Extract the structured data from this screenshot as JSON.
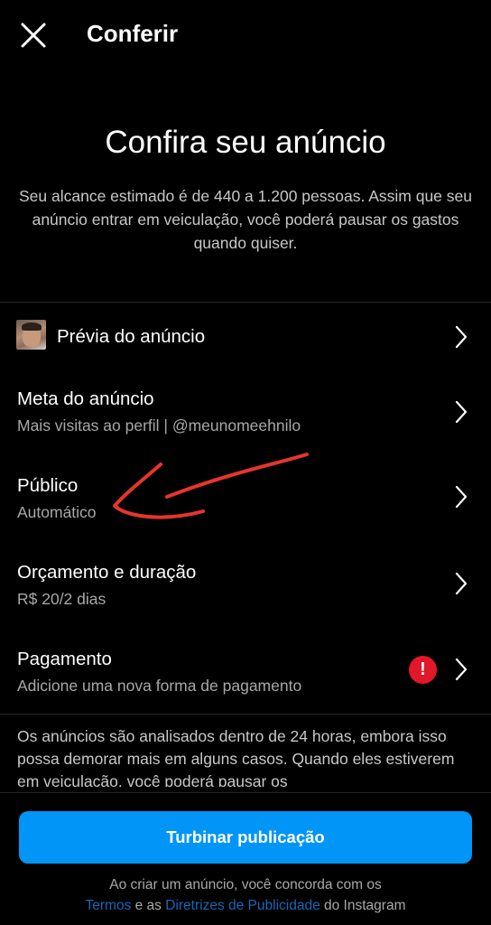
{
  "header": {
    "title": "Conferir",
    "close_icon": "close-icon"
  },
  "intro": {
    "title": "Confira seu anúncio",
    "description": "Seu alcance estimado é de 440 a 1.200 pessoas. Assim que seu anúncio entrar em veiculação, você poderá pausar os gastos quando quiser."
  },
  "rows": [
    {
      "title": "Prévia do anúncio",
      "subtitle": ""
    },
    {
      "title": "Meta do anúncio",
      "subtitle": "Mais visitas ao perfil | @meunomeehnilo"
    },
    {
      "title": "Público",
      "subtitle": "Automático"
    },
    {
      "title": "Orçamento e duração",
      "subtitle": "R$ 20/2 dias"
    },
    {
      "title": "Pagamento",
      "subtitle": "Adicione uma nova forma de pagamento",
      "alert": "!"
    }
  ],
  "notice": "Os anúncios são analisados dentro de 24 horas, embora isso possa demorar mais em alguns casos. Quando eles estiverem em veiculação, você poderá pausar os",
  "cta": {
    "label": "Turbinar publicação"
  },
  "terms": {
    "line1": "Ao criar um anúncio, você concorda com os",
    "link_terms": "Termos",
    "middle": " e as ",
    "link_guidelines": "Diretrizes de Publicidade",
    "suffix": " do Instagram"
  },
  "colors": {
    "background": "#000000",
    "primary_button": "#0095f6",
    "link": "#1a67b8",
    "alert": "#e0182a",
    "annotation": "#e8342c"
  },
  "icons": [
    "close-icon",
    "chevron-right-icon",
    "alert-icon",
    "avatar"
  ]
}
